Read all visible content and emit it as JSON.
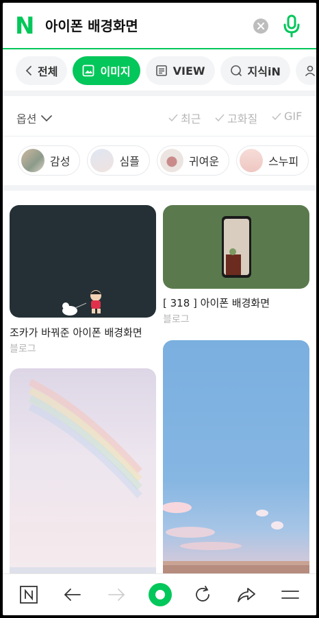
{
  "search": {
    "logo_letter": "N",
    "query": "아이폰 배경화면"
  },
  "tabs": [
    {
      "label": "전체"
    },
    {
      "label": "이미지"
    },
    {
      "label": "VIEW"
    },
    {
      "label": "지식iN"
    }
  ],
  "options": {
    "label": "옵션",
    "filters": [
      "최근",
      "고화질",
      "GIF"
    ]
  },
  "chips": [
    {
      "label": "감성"
    },
    {
      "label": "심플"
    },
    {
      "label": "귀여운"
    },
    {
      "label": "스누피"
    }
  ],
  "results": [
    {
      "caption": "조카가 바꿔준 아이폰 배경화면",
      "source": "블로그"
    },
    {
      "caption": "[ 318 ] 아이폰 배경화면",
      "source": "블로그"
    }
  ],
  "colors": {
    "brand": "#03c75a",
    "dark_thumb": "#243036",
    "green_thumb": "#5a7a4e"
  },
  "toolbar": {
    "icons": [
      "naver-home-icon",
      "back-arrow-icon",
      "forward-arrow-icon",
      "green-dot-icon",
      "refresh-icon",
      "share-icon",
      "menu-icon"
    ]
  }
}
